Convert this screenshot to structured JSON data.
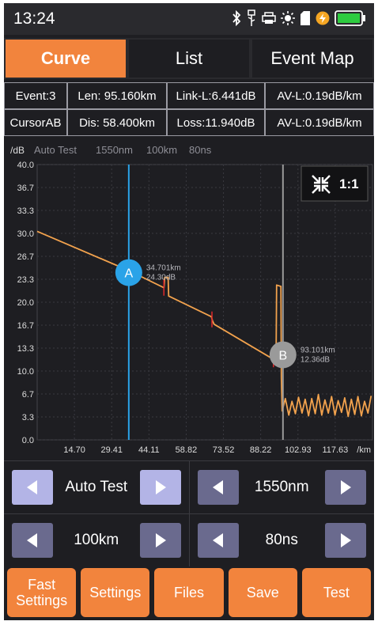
{
  "status": {
    "time": "13:24"
  },
  "tabs": [
    {
      "label": "Curve",
      "active": true
    },
    {
      "label": "List",
      "active": false
    },
    {
      "label": "Event Map",
      "active": false
    }
  ],
  "info": {
    "row1": [
      "Event:3",
      "Len: 95.160km",
      "Link-L:6.441dB",
      "AV-L:0.19dB/km"
    ],
    "row2": [
      "CursorAB",
      "Dis: 58.400km",
      "Loss:11.940dB",
      "AV-L:0.19dB/km"
    ]
  },
  "chart_data": {
    "type": "line",
    "header": {
      "yunit": "/dB",
      "mode": "Auto Test",
      "wavelength": "1550nm",
      "range": "100km",
      "pulse": "80ns"
    },
    "xunit": "/km",
    "x_ticks": [
      "14.70",
      "29.41",
      "44.11",
      "58.82",
      "73.52",
      "88.22",
      "102.93",
      "117.63"
    ],
    "y_ticks": [
      "40.0",
      "36.7",
      "33.3",
      "30.0",
      "26.7",
      "23.3",
      "20.0",
      "16.7",
      "13.3",
      "10.0",
      "6.7",
      "3.3",
      "0.0"
    ],
    "xlim": [
      0,
      127
    ],
    "ylim": [
      0,
      40
    ],
    "trace": [
      [
        0,
        30.3
      ],
      [
        34.7,
        24.6
      ],
      [
        48.0,
        22.1
      ],
      [
        48.3,
        23.6
      ],
      [
        49.6,
        23.6
      ],
      [
        49.8,
        20.9
      ],
      [
        66.0,
        17.9
      ],
      [
        66.4,
        17.3
      ],
      [
        67.0,
        16.8
      ],
      [
        89.5,
        11.7
      ],
      [
        89.8,
        11.2
      ],
      [
        90.5,
        11.6
      ],
      [
        90.7,
        22.5
      ],
      [
        92.3,
        22.3
      ],
      [
        92.5,
        9.0
      ],
      [
        92.8,
        4.2
      ],
      [
        94.0,
        6.0
      ],
      [
        95.3,
        3.6
      ],
      [
        96.5,
        5.6
      ],
      [
        97.8,
        3.8
      ],
      [
        99.0,
        6.2
      ],
      [
        100.3,
        3.9
      ],
      [
        101.5,
        5.9
      ],
      [
        102.8,
        3.5
      ],
      [
        104.0,
        6.0
      ],
      [
        105.3,
        3.8
      ],
      [
        106.5,
        6.6
      ],
      [
        107.8,
        3.6
      ],
      [
        109.0,
        5.8
      ],
      [
        110.3,
        3.9
      ],
      [
        111.5,
        6.3
      ],
      [
        112.8,
        3.6
      ],
      [
        114.0,
        5.7
      ],
      [
        115.3,
        4.0
      ],
      [
        116.5,
        6.1
      ],
      [
        117.8,
        3.4
      ],
      [
        119.0,
        5.9
      ],
      [
        120.3,
        3.7
      ],
      [
        121.5,
        6.3
      ],
      [
        122.8,
        3.5
      ],
      [
        124.0,
        5.6
      ],
      [
        125.3,
        3.9
      ],
      [
        126.5,
        6.4
      ]
    ],
    "events": [
      {
        "x": 48.0,
        "y": 22.1
      },
      {
        "x": 66.2,
        "y": 17.5
      },
      {
        "x": 89.5,
        "y": 11.7
      }
    ],
    "cursors": [
      {
        "label": "A",
        "x": 34.7,
        "y": 24.3,
        "readout_x": "34.701km",
        "readout_y": "24.30dB",
        "color": "#2aa3e8"
      },
      {
        "label": "B",
        "x": 93.1,
        "y": 12.36,
        "readout_x": "93.101km",
        "readout_y": "12.36dB",
        "color": "#9a9a9a"
      }
    ],
    "zoom_label": "1:1",
    "trace_color": "#f2a24d"
  },
  "controls": {
    "mode": "Auto Test",
    "wavelength": "1550nm",
    "range": "100km",
    "pulse": "80ns"
  },
  "buttons": {
    "fast_settings_1": "Fast",
    "fast_settings_2": "Settings",
    "settings": "Settings",
    "files": "Files",
    "save": "Save",
    "test": "Test"
  }
}
